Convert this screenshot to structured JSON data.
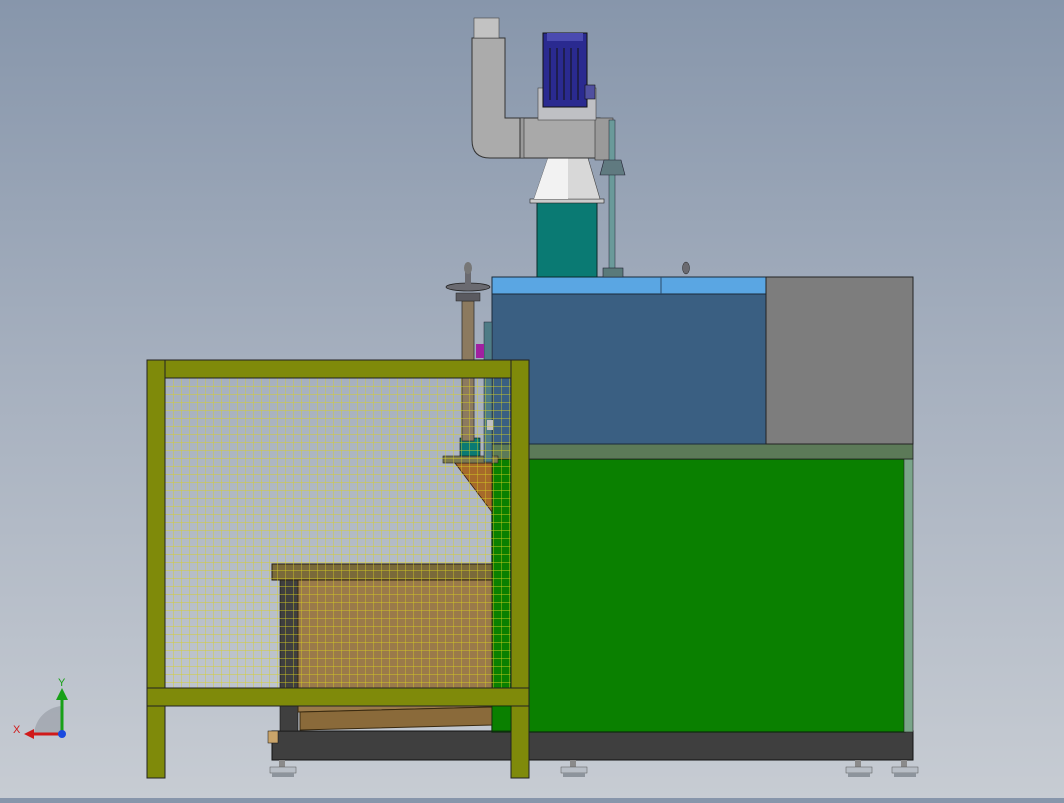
{
  "triad": {
    "x_label": "X",
    "y_label": "Y"
  },
  "colors": {
    "background_top": "#8796ab",
    "background_bottom": "#c7ccd3",
    "fence_frame": "#7f8a0a",
    "fence_mesh": "#d8d020",
    "tank_green": "#0a8000",
    "hood_blue": "#3a5f82",
    "hood_top": "#5aa6e3",
    "side_panel_gray": "#7d7d7d",
    "base_frame": "#3f3f3f",
    "wooden_hopper": "#9a7a4a",
    "motor_blue": "#2a2a90",
    "duct_gray": "#a9a9a9",
    "column_teal": "#0a7a73",
    "x_axis_red": "#d01a1a",
    "y_axis_green": "#18a018",
    "z_axis_blue": "#1a4adf"
  }
}
